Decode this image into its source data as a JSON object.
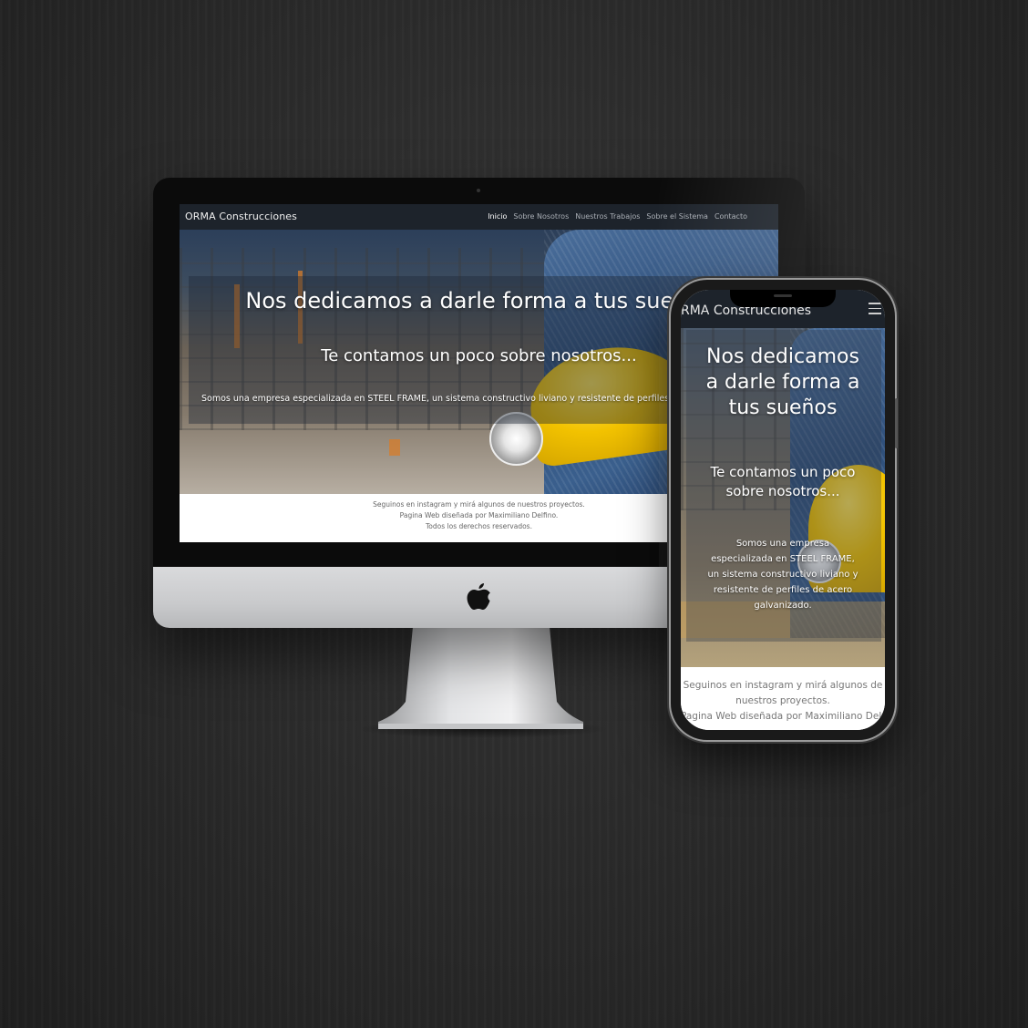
{
  "site": {
    "brand": "ORMA Construcciones",
    "nav": {
      "items": [
        "Inicio",
        "Sobre Nosotros",
        "Nuestros Trabajos",
        "Sobre el Sistema",
        "Contacto"
      ],
      "active": "Inicio"
    },
    "hero": {
      "headline": "Nos dedicamos a darle forma a tus sueños",
      "subheadline": "Te contamos un poco sobre nosotros...",
      "paragraph_desktop": "Somos una empresa especializada en STEEL FRAME, un sistema constructivo liviano y resistente de perfiles de",
      "paragraph_mobile": "Somos una empresa especializada en STEEL FRAME, un sistema constructivo liviano y resistente de perfiles de acero galvanizado."
    },
    "footer": {
      "line1": "Seguinos en instagram y mirá algunos de nuestros proyectos.",
      "line2": "Pagina Web diseñada por Maximiliano Delfino.",
      "line3": "Todos los derechos reservados."
    }
  },
  "mobile": {
    "brand_visible": "RMA Construcciones",
    "menu_icon": "hamburger-icon",
    "headline_lines": [
      "Nos dedicamos",
      "a darle forma a",
      "tus sueños"
    ],
    "subheadline_lines": [
      "Te contamos un poco",
      "sobre nosotros..."
    ],
    "paragraph_lines": [
      "Somos una empresa",
      "especializada en STEEL FRAME,",
      "un sistema constructivo liviano y",
      "resistente de perfiles de acero",
      "galvanizado."
    ],
    "footer_lines": [
      "Seguinos en instagram y mirá algunos de",
      "nuestros proyectos.",
      "Pagina Web diseñada por Maximiliano Delfino."
    ]
  },
  "colors": {
    "background": "#2b2b2b",
    "navbar": "#1d232b",
    "helmet": "#f2c200",
    "footer_bg": "#ffffff"
  },
  "icons": {
    "device_logo": "apple-logo-icon"
  }
}
